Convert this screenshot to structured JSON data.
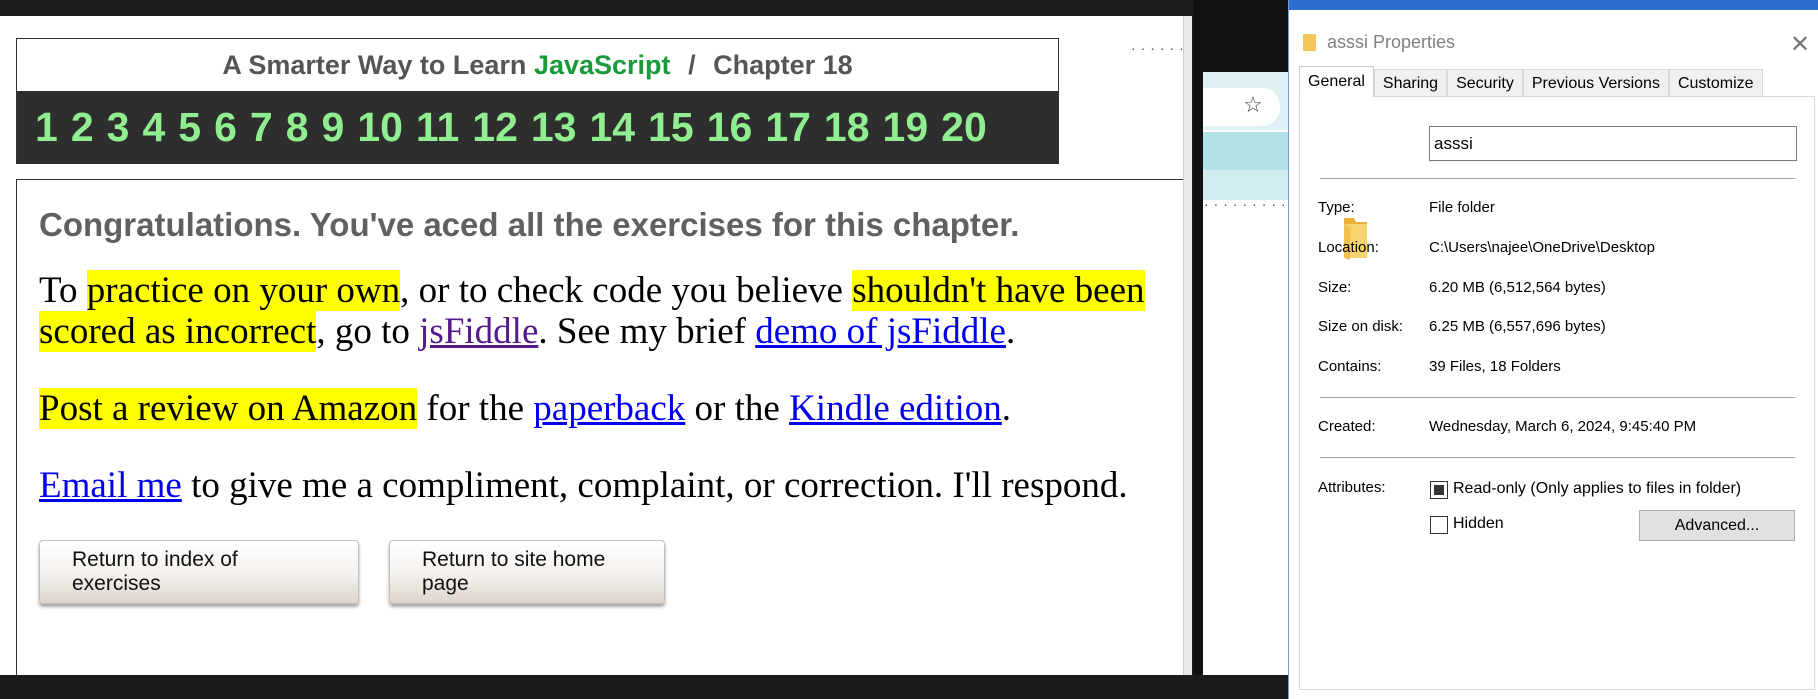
{
  "webpage": {
    "title_prefix": "A Smarter Way to Learn",
    "title_js": "JavaScript",
    "title_sep": "/",
    "title_chapter": "Chapter 18",
    "chapters": [
      "1",
      "2",
      "3",
      "4",
      "5",
      "6",
      "7",
      "8",
      "9",
      "10",
      "11",
      "12",
      "13",
      "14",
      "15",
      "16",
      "17",
      "18",
      "19",
      "20"
    ],
    "congrats": "Congratulations. You've aced all the exercises for this chapter.",
    "p1": {
      "a": "To ",
      "hl1": "practice on your own",
      "b": ", or to check code you believe ",
      "hl2": "shouldn't have been scored as incorrect",
      "c": ", go to ",
      "link_jsfiddle": "jsFiddle",
      "d": ". See my brief ",
      "link_demo": "demo of jsFiddle",
      "e": "."
    },
    "p2": {
      "hl": "Post a review on Amazon",
      "a": " for the ",
      "link_paperback": "paperback",
      "b": " or the ",
      "link_kindle": "Kindle edition",
      "c": "."
    },
    "p3": {
      "link_email": "Email me",
      "a": " to give me a compliment, complaint, or correction. I'll respond."
    },
    "buttons": {
      "index": "Return to index of exercises",
      "home": "Return to site home page"
    }
  },
  "background_window": {
    "star_icon": "star-icon"
  },
  "dialog": {
    "title": "asssi Properties",
    "tabs": [
      "General",
      "Sharing",
      "Security",
      "Previous Versions",
      "Customize"
    ],
    "active_tab": "General",
    "name_value": "asssi",
    "type_label": "Type:",
    "type_value": "File folder",
    "location_label": "Location:",
    "location_value": "C:\\Users\\najee\\OneDrive\\Desktop",
    "size_label": "Size:",
    "size_value": "6.20 MB (6,512,564 bytes)",
    "size_disk_label": "Size on disk:",
    "size_disk_value": "6.25 MB (6,557,696 bytes)",
    "contains_label": "Contains:",
    "contains_value": "39 Files, 18 Folders",
    "created_label": "Created:",
    "created_value": "Wednesday, March 6, 2024, 9:45:40 PM",
    "attributes_label": "Attributes:",
    "readonly_label": "Read-only (Only applies to files in folder)",
    "hidden_label": "Hidden",
    "advanced_button": "Advanced..."
  },
  "colors": {
    "highlight": "#ffff00",
    "chapter_green": "#90ee90",
    "js_green": "#1a9a3a",
    "link_blue": "#0000ee",
    "link_visited": "#551a8b",
    "dialog_accent": "#2c6fd1"
  }
}
